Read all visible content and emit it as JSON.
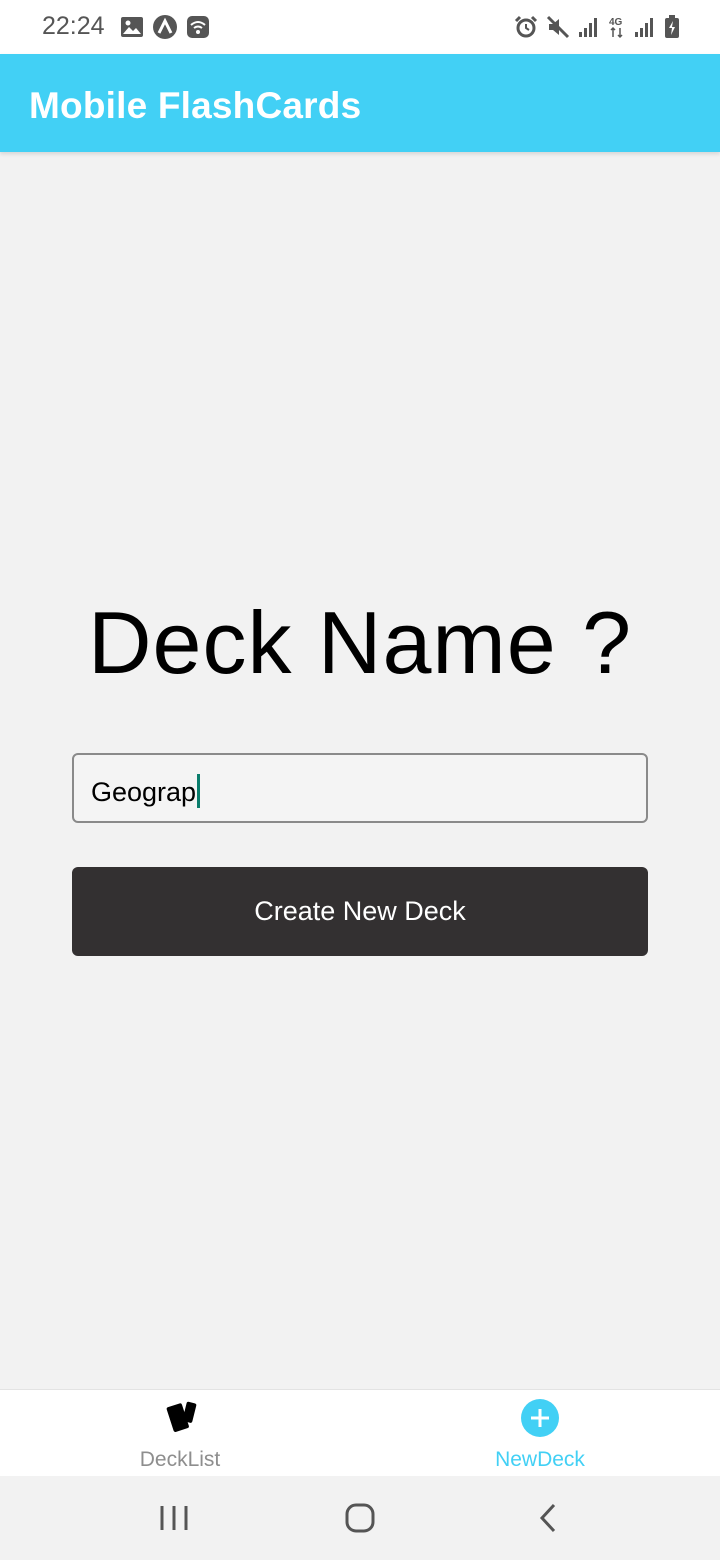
{
  "status_bar": {
    "time": "22:24",
    "left_icons": [
      "image-icon",
      "app-notification-icon",
      "wifi-calling-icon"
    ],
    "right_icons": [
      "alarm-icon",
      "mute-icon",
      "signal-icon",
      "4g-icon",
      "signal-icon",
      "battery-charging-icon"
    ]
  },
  "header": {
    "title": "Mobile FlashCards",
    "color": "#42d0f5"
  },
  "form": {
    "title": "Deck Name ?",
    "input_value": "Geograp",
    "submit_label": "Create New Deck",
    "button_color": "#333031"
  },
  "tabs": [
    {
      "label": "DeckList",
      "icon": "cards-icon",
      "active": false
    },
    {
      "label": "NewDeck",
      "icon": "plus-circle-icon",
      "active": true,
      "color": "#42d0f5"
    }
  ],
  "system_nav": {
    "buttons": [
      "recents-icon",
      "home-icon",
      "back-icon"
    ]
  }
}
